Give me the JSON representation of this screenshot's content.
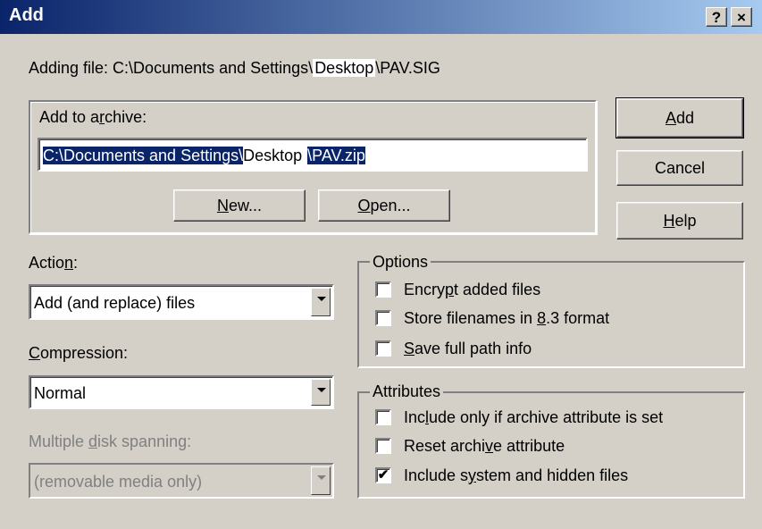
{
  "title": "Add",
  "titlebar": {
    "help": "?",
    "close": "×"
  },
  "adding_file_prefix": "Adding file: C:\\Documents and Settings\\",
  "adding_file_highlight": "Desktop",
  "adding_file_suffix": "\\PAV.SIG",
  "archive": {
    "group_label": "Add to archive:",
    "path_sel1": "C:\\Documents and Settings\\",
    "path_mid": "Desktop",
    "path_sel2": "\\PAV.zip",
    "new_label": "New...",
    "open_label": "Open..."
  },
  "buttons": {
    "add": "Add",
    "cancel": "Cancel",
    "help": "Help"
  },
  "action": {
    "label": "Action:",
    "value": "Add (and replace) files"
  },
  "compression": {
    "label": "Compression:",
    "value": "Normal"
  },
  "spanning": {
    "label": "Multiple disk spanning:",
    "value": "(removable media only)"
  },
  "options": {
    "label": "Options",
    "items": [
      {
        "label": "Encrypt added files",
        "checked": false
      },
      {
        "label": "Store filenames in 8.3 format",
        "checked": false
      },
      {
        "label": "Save full path info",
        "checked": false
      }
    ]
  },
  "attributes": {
    "label": "Attributes",
    "items": [
      {
        "label": "Include only if archive attribute is set",
        "checked": false
      },
      {
        "label": "Reset archive attribute",
        "checked": false
      },
      {
        "label": "Include system and hidden files",
        "checked": true
      }
    ]
  },
  "check_mark": "✔"
}
